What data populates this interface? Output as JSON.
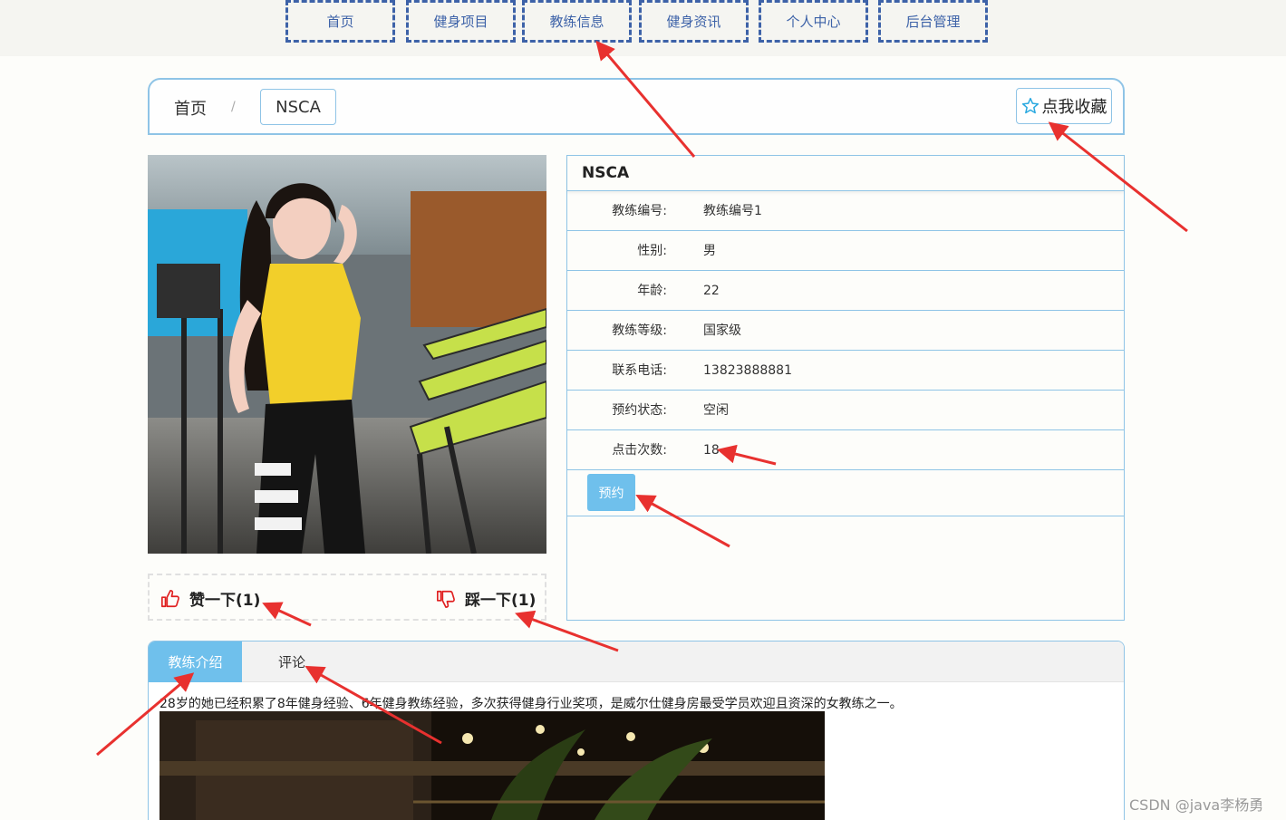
{
  "nav": [
    {
      "label": "首页"
    },
    {
      "label": "健身项目"
    },
    {
      "label": "教练信息"
    },
    {
      "label": "健身资讯"
    },
    {
      "label": "个人中心"
    },
    {
      "label": "后台管理"
    }
  ],
  "breadcrumb": {
    "home": "首页",
    "separator": "/",
    "current": "NSCA"
  },
  "favorite": {
    "label": "点我收藏",
    "icon": "star-outline-icon"
  },
  "coach": {
    "name": "NSCA",
    "fields": [
      {
        "label": "教练编号:",
        "value": "教练编号1"
      },
      {
        "label": "性别:",
        "value": "男"
      },
      {
        "label": "年龄:",
        "value": "22"
      },
      {
        "label": "教练等级:",
        "value": "国家级"
      },
      {
        "label": "联系电话:",
        "value": "13823888881"
      },
      {
        "label": "预约状态:",
        "value": "空闲"
      },
      {
        "label": "点击次数:",
        "value": "18"
      }
    ],
    "book_label": "预约"
  },
  "votes": {
    "like_label": "赞一下(1)",
    "dislike_label": "踩一下(1)",
    "like_icon": "thumbs-up-icon",
    "dislike_icon": "thumbs-down-icon"
  },
  "tabs": [
    {
      "label": "教练介绍",
      "active": true
    },
    {
      "label": "评论",
      "active": false
    }
  ],
  "intro": {
    "text": "28岁的她已经积累了8年健身经验、6年健身教练经验，多次获得健身行业奖项，是威尔仕健身房最受学员欢迎且资深的女教练之一。"
  },
  "watermark": "CSDN @java李杨勇",
  "colors": {
    "accent": "#6fc0ec",
    "nav": "#3d62a8",
    "border": "#8fc4e6",
    "arrow": "#e8312f"
  }
}
